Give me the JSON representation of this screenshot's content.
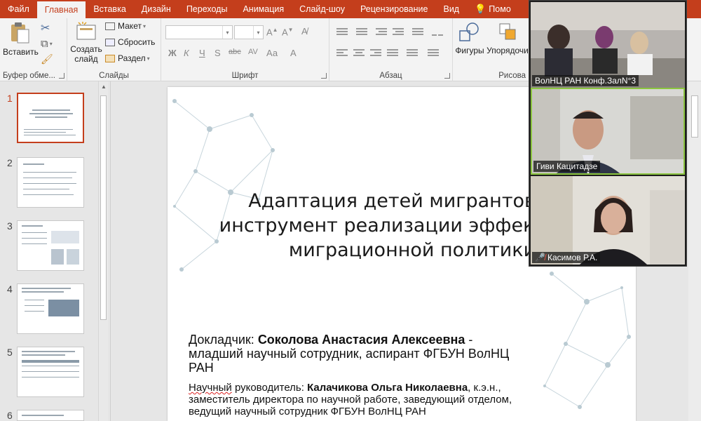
{
  "tabs": [
    {
      "label": "Файл",
      "active": false
    },
    {
      "label": "Главная",
      "active": true
    },
    {
      "label": "Вставка",
      "active": false
    },
    {
      "label": "Дизайн",
      "active": false
    },
    {
      "label": "Переходы",
      "active": false
    },
    {
      "label": "Анимация",
      "active": false
    },
    {
      "label": "Слайд-шоу",
      "active": false
    },
    {
      "label": "Рецензирование",
      "active": false
    },
    {
      "label": "Вид",
      "active": false
    },
    {
      "label": "Помо",
      "active": false
    }
  ],
  "ribbon": {
    "clipboard": {
      "paste": "Вставить",
      "label": "Буфер обме..."
    },
    "slides": {
      "new_slide": "Создать слайд",
      "layout": "Макет",
      "reset": "Сбросить",
      "section": "Раздел",
      "label": "Слайды"
    },
    "font": {
      "bold": "Ж",
      "italic": "К",
      "underline": "Ч",
      "strike": "S",
      "spacing": "abc",
      "aa": "Аа",
      "label": "Шрифт"
    },
    "paragraph": {
      "label": "Абзац"
    },
    "drawing": {
      "shapes": "Фигуры",
      "arrange": "Упорядочи",
      "label": "Рисова"
    }
  },
  "thumbnails": [
    {
      "number": "1",
      "active": true
    },
    {
      "number": "2",
      "active": false
    },
    {
      "number": "3",
      "active": false
    },
    {
      "number": "4",
      "active": false
    },
    {
      "number": "5",
      "active": false
    },
    {
      "number": "6",
      "active": false
    }
  ],
  "slide": {
    "title": "Адаптация детей мигрантов как\nинструмент реализации эффективной\nмиграционной политики",
    "reporter_prefix": "Докладчик: ",
    "reporter_name": "Соколова Анастасия Алексеевна",
    "reporter_rest": " - младший научный сотрудник,  аспирант ФГБУН ВолНЦ РАН",
    "advisor_prefix": "руководитель:  ",
    "advisor_word": "Научный",
    "advisor_name": "Калачикова Ольга Николаевна",
    "advisor_rest": ", к.э.н., заместитель директора по научной работе, заведующий отделом, ведущий научный сотрудник ФГБУН ВолНЦ РАН"
  },
  "video": {
    "participants": [
      {
        "name": "ВолНЦ РАН Конф.ЗалN°3",
        "muted": false,
        "active": false
      },
      {
        "name": "Гиви Кацитадзе",
        "muted": false,
        "active": true
      },
      {
        "name": "Касимов Р.А.",
        "muted": true,
        "active": false
      }
    ]
  },
  "colors": {
    "accent": "#c43e1c",
    "active_speaker": "#8bc53f"
  }
}
